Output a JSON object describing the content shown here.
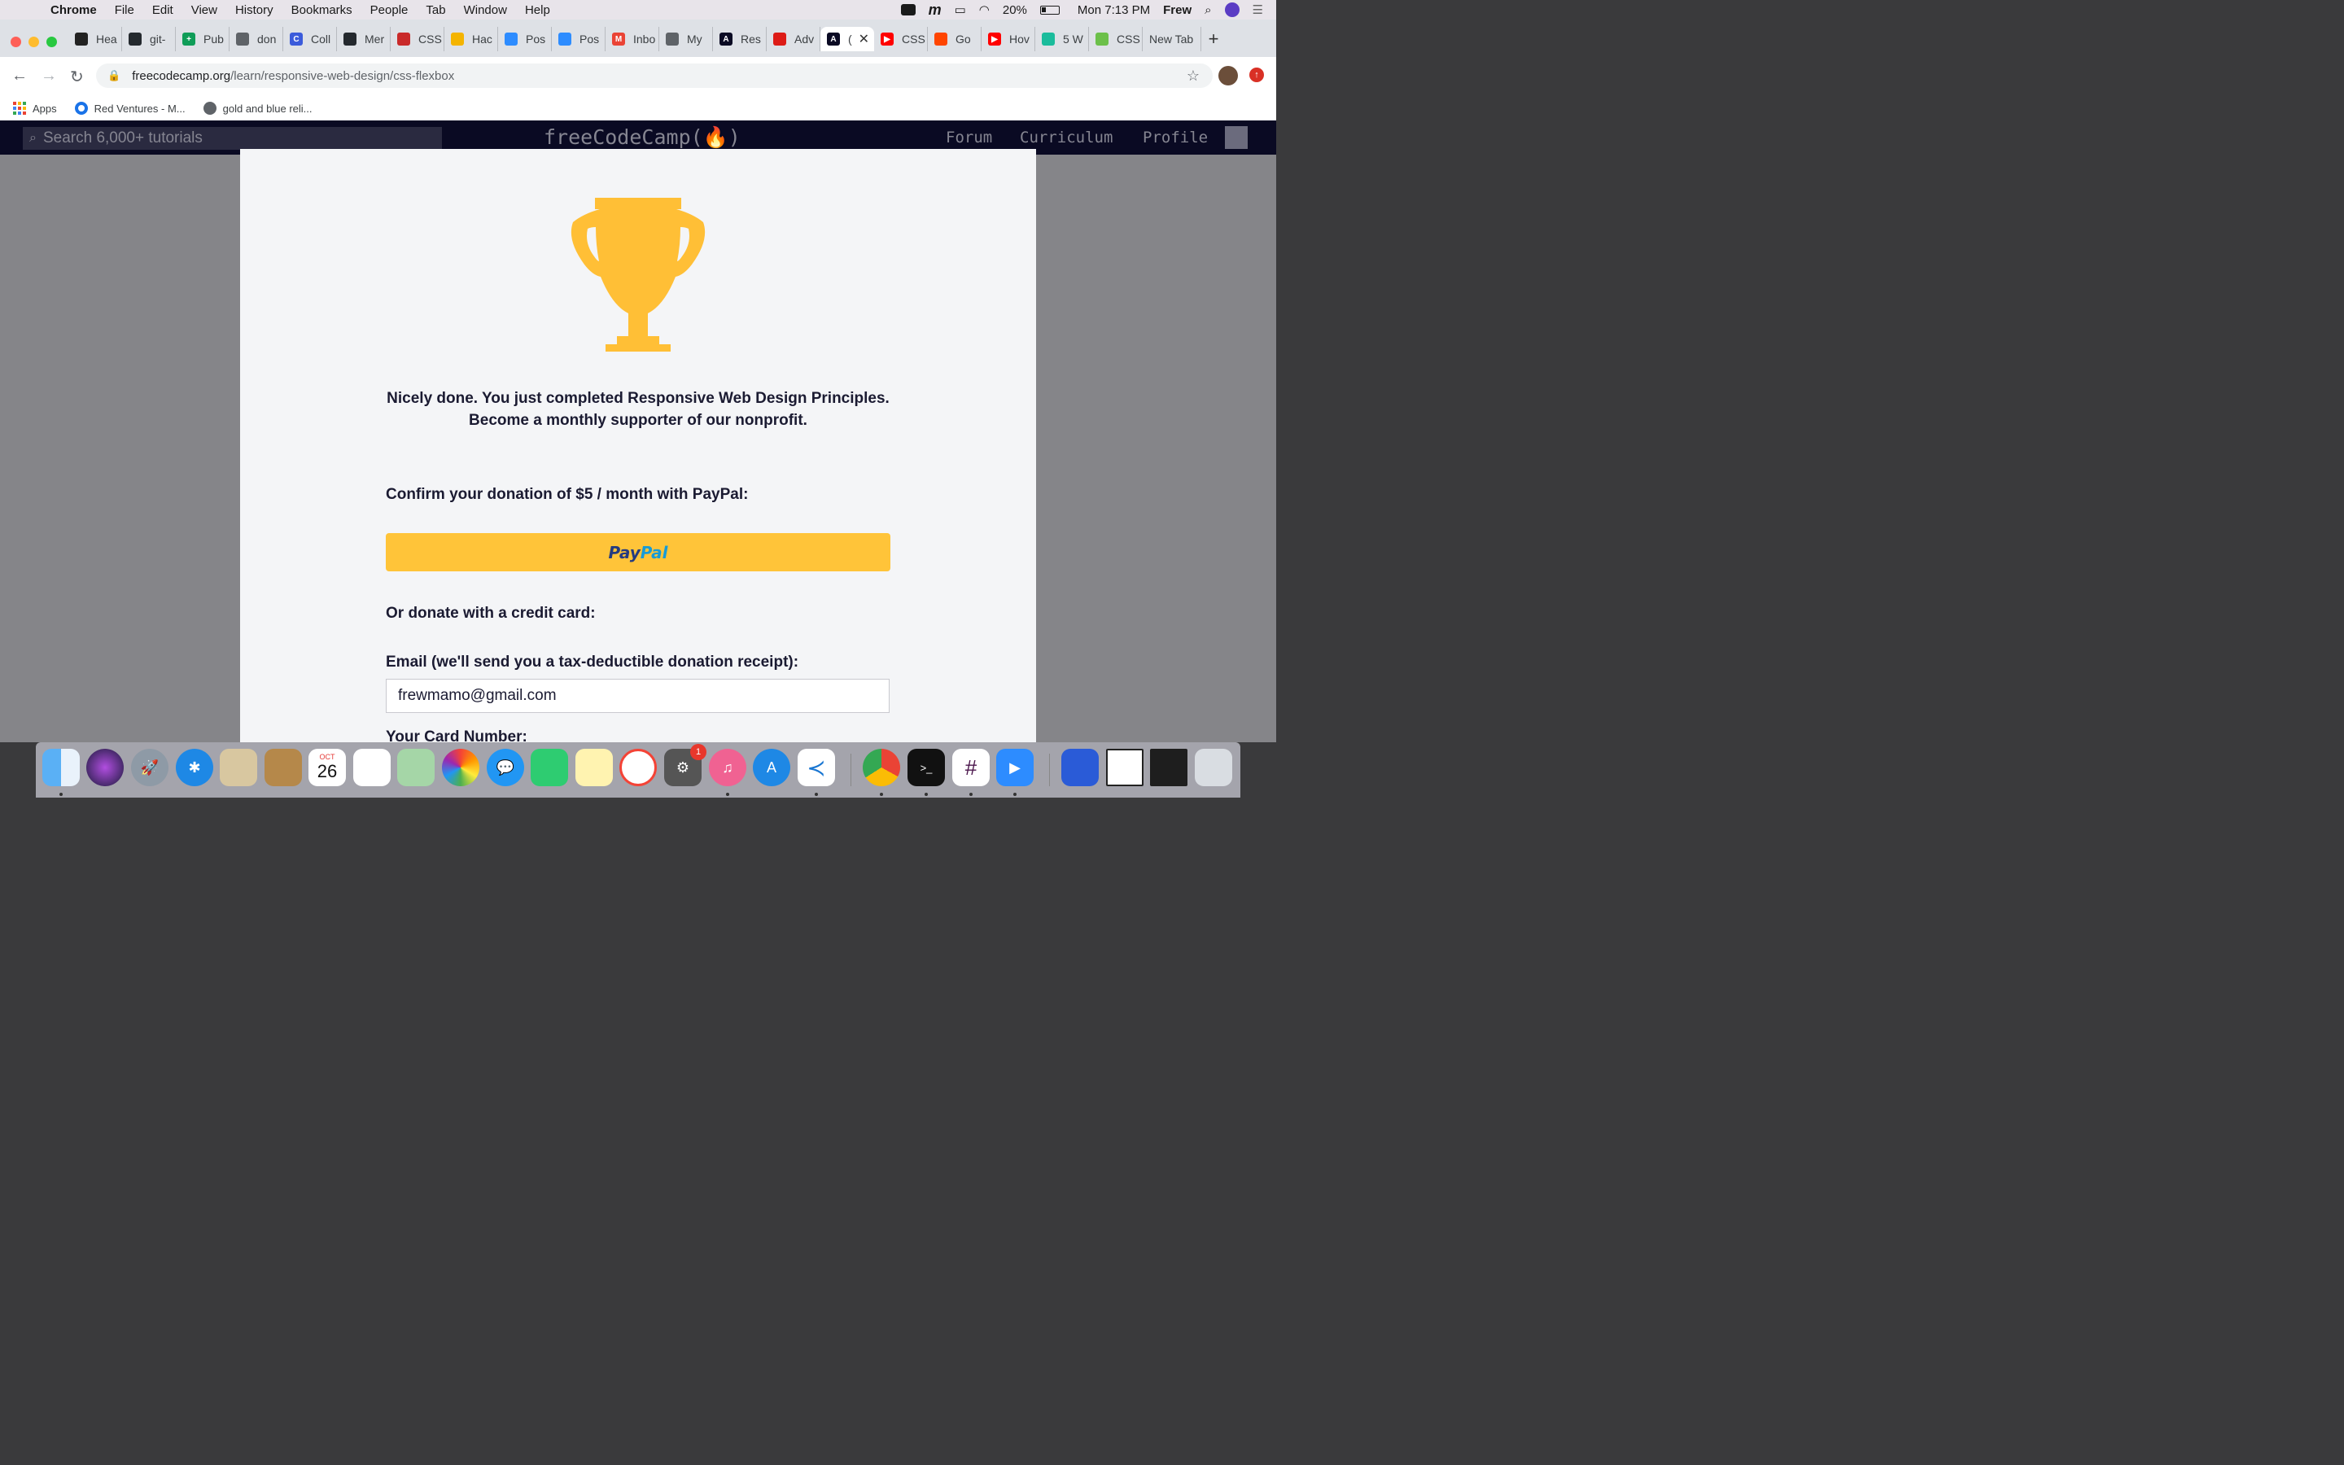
{
  "menubar": {
    "app": "Chrome",
    "items": [
      "File",
      "Edit",
      "View",
      "History",
      "Bookmarks",
      "People",
      "Tab",
      "Window",
      "Help"
    ],
    "battery": "20%",
    "clock": "Mon 7:13 PM",
    "user": "Frew"
  },
  "tabs": [
    {
      "label": "Hea",
      "fav": "#222",
      "glyph": ""
    },
    {
      "label": "git-",
      "fav": "#24292e",
      "glyph": ""
    },
    {
      "label": "Pub",
      "fav": "#0f9d58",
      "glyph": "+"
    },
    {
      "label": "don",
      "fav": "#5f6368",
      "glyph": ""
    },
    {
      "label": "Coll",
      "fav": "#3b5bdb",
      "glyph": "C"
    },
    {
      "label": "Mer",
      "fav": "#24292e",
      "glyph": ""
    },
    {
      "label": "CSS",
      "fav": "#c92a2a",
      "glyph": ""
    },
    {
      "label": "Hac",
      "fav": "#f4b400",
      "glyph": ""
    },
    {
      "label": "Pos",
      "fav": "#2d8cff",
      "glyph": ""
    },
    {
      "label": "Pos",
      "fav": "#2d8cff",
      "glyph": ""
    },
    {
      "label": "Inbo",
      "fav": "#ea4335",
      "glyph": "M"
    },
    {
      "label": "My",
      "fav": "#5f6368",
      "glyph": ""
    },
    {
      "label": "Res",
      "fav": "#0a0a23",
      "glyph": "A"
    },
    {
      "label": "Adv",
      "fav": "#dd1b16",
      "glyph": ""
    },
    {
      "label": "(",
      "fav": "#0a0a23",
      "glyph": "A",
      "active": true
    },
    {
      "label": "CSS",
      "fav": "#ff0000",
      "glyph": "▶"
    },
    {
      "label": "Go",
      "fav": "#ff4500",
      "glyph": ""
    },
    {
      "label": "Hov",
      "fav": "#ff0000",
      "glyph": "▶"
    },
    {
      "label": "5 W",
      "fav": "#1abc9c",
      "glyph": ""
    },
    {
      "label": "CSS",
      "fav": "#6cc04a",
      "glyph": ""
    },
    {
      "label": "New Tab",
      "fav": "",
      "glyph": ""
    }
  ],
  "url": {
    "host": "freecodecamp.org",
    "path": "/learn/responsive-web-design/css-flexbox"
  },
  "bookmarks": [
    {
      "label": "Apps"
    },
    {
      "label": "Red Ventures - M..."
    },
    {
      "label": "gold and blue reli..."
    }
  ],
  "fcc": {
    "search_placeholder": "Search 6,000+ tutorials",
    "logo": "freeCodeCamp(🔥)",
    "nav": [
      "Forum",
      "Curriculum",
      "Profile"
    ]
  },
  "modal": {
    "message_line1": "Nicely done. You just completed Responsive Web Design Principles.",
    "message_line2": "Become a monthly supporter of our nonprofit.",
    "paypal_prompt": "Confirm your donation of $5 / month with PayPal:",
    "paypal_pay": "Pay",
    "paypal_pal": "Pal",
    "card_prompt": "Or donate with a credit card:",
    "email_label": "Email (we'll send you a tax-deductible donation receipt):",
    "email_value": "frewmamo@gmail.com",
    "card_number_label": "Your Card Number:",
    "trophy_color": "#ffbf36"
  },
  "dock": {
    "calendar_month": "OCT",
    "calendar_day": "26",
    "settings_badge": "1"
  }
}
